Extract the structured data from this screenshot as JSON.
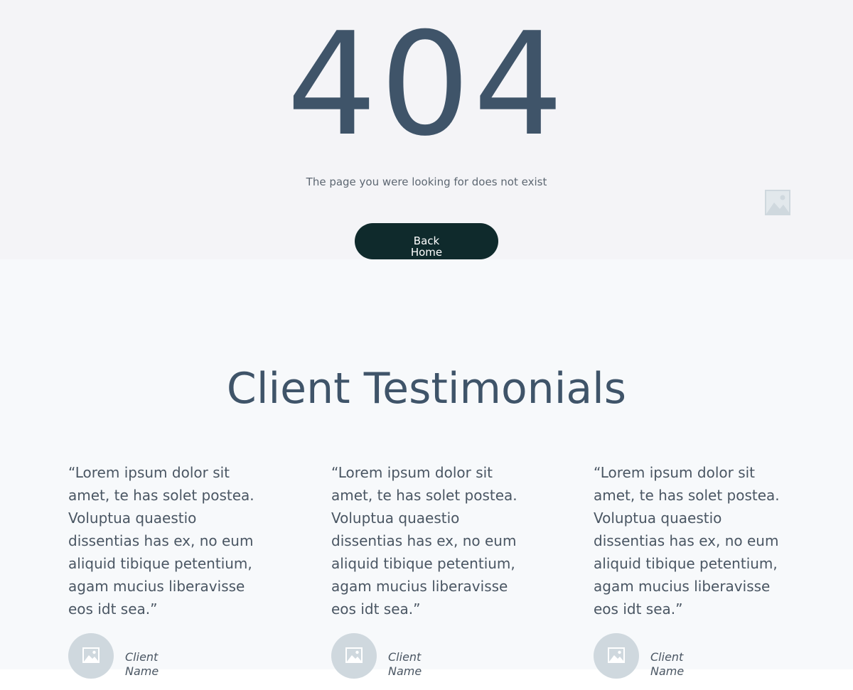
{
  "hero": {
    "code": "404",
    "message": "The page you were looking for does not exist",
    "back_button": "Back Home",
    "placeholder_icon": "image-placeholder-icon"
  },
  "testimonials": {
    "title": "Client Testimonials",
    "items": [
      {
        "quote": "“Lorem ipsum dolor sit amet, te has solet postea. Voluptua quaestio dissentias has ex, no eum aliquid tibique petentium, agam mucius liberavisse eos idt sea.”",
        "client_name": "Client Name",
        "avatar_icon": "image-placeholder-icon"
      },
      {
        "quote": "“Lorem ipsum dolor sit amet, te has solet postea. Voluptua quaestio dissentias has ex, no eum aliquid tibique petentium, agam mucius liberavisse eos idt sea.”",
        "client_name": "Client Name",
        "avatar_icon": "image-placeholder-icon"
      },
      {
        "quote": "“Lorem ipsum dolor sit amet, te has solet postea. Voluptua quaestio dissentias has ex, no eum aliquid tibique petentium, agam mucius liberavisse eos idt sea.”",
        "client_name": "Client Name",
        "avatar_icon": "image-placeholder-icon"
      }
    ]
  },
  "colors": {
    "hero_bg": "#f4f4f7",
    "section_bg": "#f7f9fb",
    "heading": "#3f5469",
    "button_bg": "#0f2a2c",
    "avatar_bg": "#cfd8de"
  }
}
